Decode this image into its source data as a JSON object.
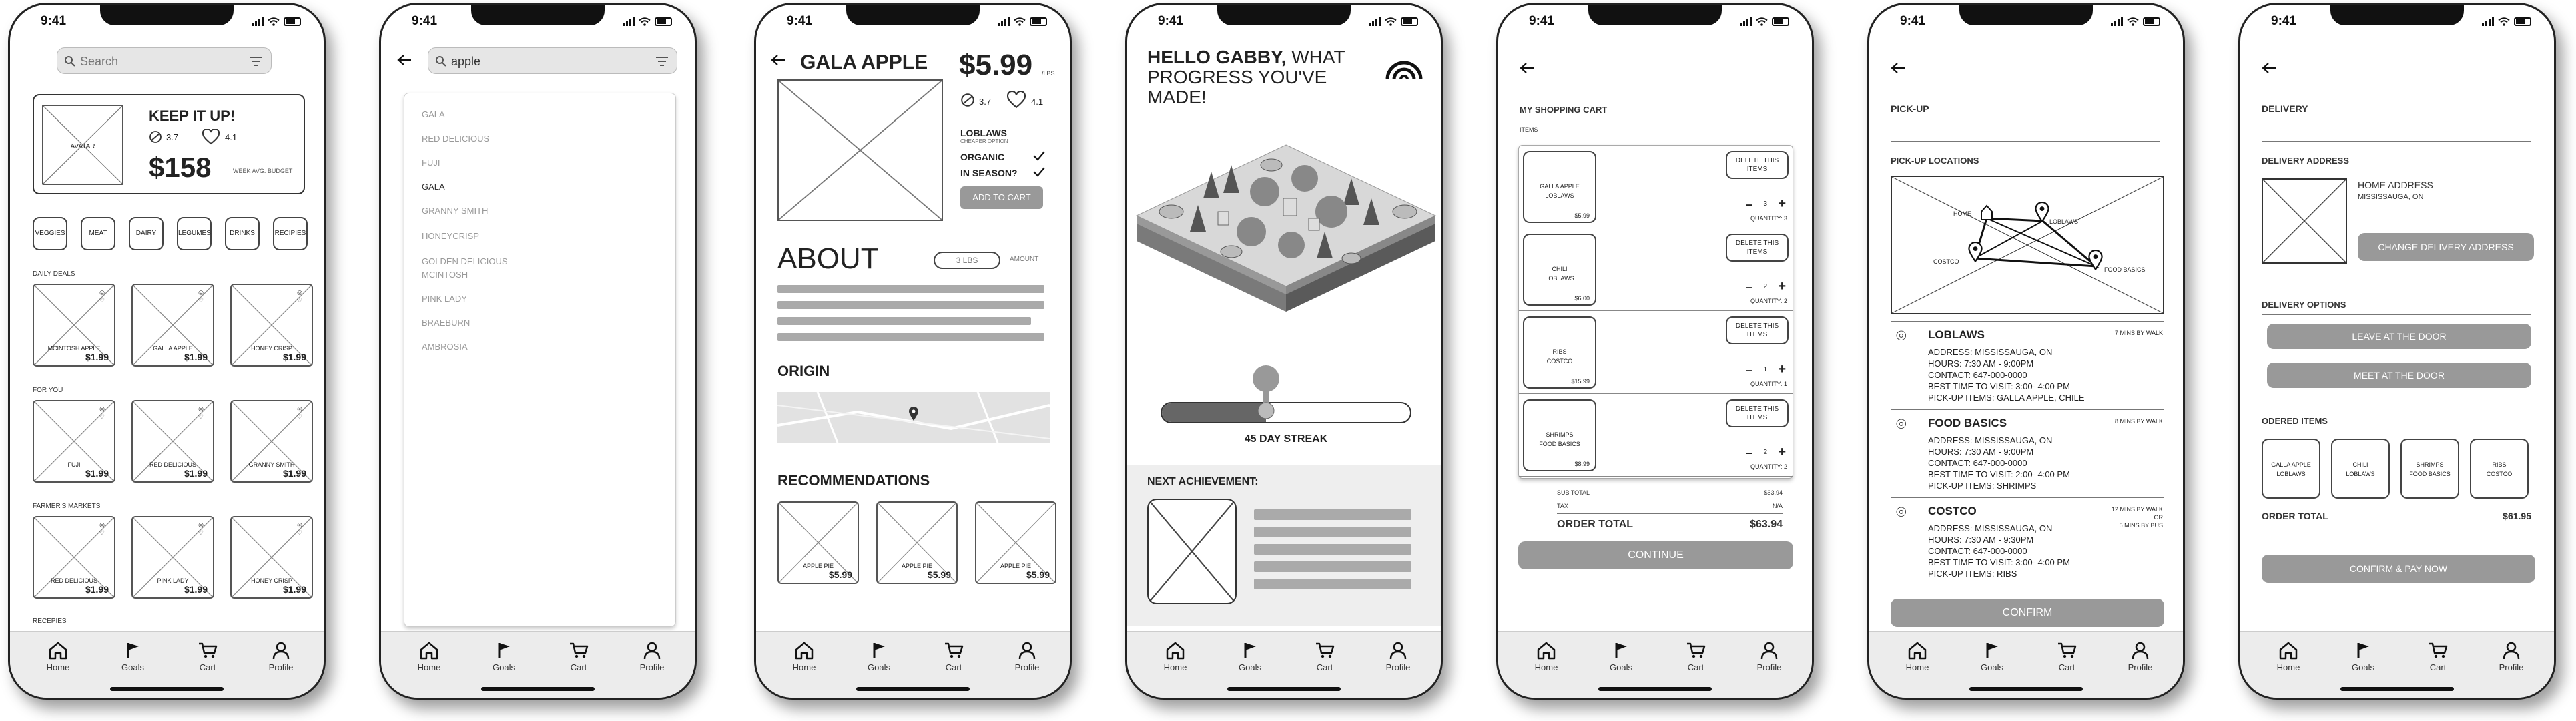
{
  "status_time": "9:41",
  "tabs": [
    "Home",
    "Goals",
    "Cart",
    "Profile"
  ],
  "screen1": {
    "search_placeholder": "Search",
    "avatar": "AVATAR",
    "title": "KEEP IT UP!",
    "stat1": "3.7",
    "stat2": "4.1",
    "budget": "$158",
    "budget_label": "WEEK AVG. BUDGET",
    "categories": [
      "VEGGIES",
      "MEAT",
      "DAIRY",
      "LEGUMES",
      "DRINKS",
      "RECIPIES"
    ],
    "sections": [
      {
        "title": "DAILY DEALS",
        "items": [
          {
            "name": "MCINTOSH APPLE",
            "price": "$1.99"
          },
          {
            "name": "GALLA APPLE",
            "price": "$1.99"
          },
          {
            "name": "HONEY CRISP",
            "price": "$1.99"
          }
        ]
      },
      {
        "title": "FOR YOU",
        "items": [
          {
            "name": "FUJI",
            "price": "$1.99"
          },
          {
            "name": "RED DELICIOUS",
            "price": "$1.99"
          },
          {
            "name": "GRANNY SMITH",
            "price": "$1.99"
          }
        ]
      },
      {
        "title": "FARMER'S MARKETS",
        "items": [
          {
            "name": "RED DELICIOUS",
            "price": "$1.99"
          },
          {
            "name": "PINK LADY",
            "price": "$1.99"
          },
          {
            "name": "HONEY CRISP",
            "price": "$1.99"
          }
        ]
      }
    ],
    "recepies_title": "RECEPIES"
  },
  "screen2": {
    "search_value": "apple",
    "results": [
      "GALA",
      "RED DELICIOUS",
      "FUJI",
      "GALA",
      "GRANNY SMITH",
      "HONEYCRISP",
      "GOLDEN DELICIOUS",
      "MCINTOSH",
      "PINK LADY",
      "BRAEBURN",
      "AMBROSIA"
    ]
  },
  "screen3": {
    "title": "GALA APPLE",
    "price": "$5.99",
    "price_unit": "/LBS",
    "stat1": "3.7",
    "stat2": "4.1",
    "store": "LOBLAWS",
    "store_sub": "CHEAPER OPTION",
    "organic": "ORGANIC",
    "in_season": "IN SEASON?",
    "add_to_cart": "ADD TO CART",
    "about": "ABOUT",
    "amount_value": "3 LBS",
    "amount_label": "AMOUNT",
    "origin": "ORIGIN",
    "recommendations": "RECOMMENDATIONS",
    "recs": [
      {
        "name": "APPLE PIE",
        "price": "$5.99"
      },
      {
        "name": "APPLE PIE",
        "price": "$5.99"
      },
      {
        "name": "APPLE PIE",
        "price": "$5.99"
      }
    ]
  },
  "screen4": {
    "greeting_bold": "HELLO GABBY,",
    "greeting_rest": "WHAT",
    "greeting_line2": "PROGRESS YOU'VE",
    "greeting_line3": "MADE!",
    "streak": "45 DAY STREAK",
    "streak_progress": 0.42,
    "next_achievement": "NEXT ACHIEVEMENT:"
  },
  "screen5": {
    "title": "MY SHOPPING CART",
    "items_label": "ITEMS",
    "items": [
      {
        "name": "GALLA APPLE",
        "store": "LOBLAWS",
        "price": "$5.99",
        "qty": "QUANTITY: 3",
        "n": "3"
      },
      {
        "name": "CHILI",
        "store": "LOBLAWS",
        "price": "$6.00",
        "qty": "QUANTITY: 2",
        "n": "2"
      },
      {
        "name": "RIBS",
        "store": "COSTCO",
        "price": "$15.99",
        "qty": "QUANTITY: 1",
        "n": "1"
      },
      {
        "name": "SHRIMPS",
        "store": "FOOD BASICS",
        "price": "$8.99",
        "qty": "QUANTITY: 2",
        "n": "2"
      }
    ],
    "delete_label": "DELETE THIS ITEMS",
    "sub_total_label": "SUB TOTAL",
    "sub_total": "$63.94",
    "tax_label": "TAX",
    "tax": "N/A",
    "order_total_label": "ORDER TOTAL",
    "order_total": "$63.94",
    "continue": "CONTINUE"
  },
  "screen6": {
    "title": "PICK-UP",
    "locations_title": "PICK-UP LOCATIONS",
    "map_labels": [
      "HOME",
      "LOBLAWS",
      "COSTCO",
      "FOOD BASICS"
    ],
    "stores": [
      {
        "name": "LOBLAWS",
        "distance": "7 MINS BY WALK",
        "address": "ADDRESS:  MISSISSAUGA, ON",
        "hours": "HOURS:  7:30 AM - 9:00PM",
        "contact": "CONTACT:  647-000-0000",
        "best": "BEST TIME TO VISIT:  3:00- 4:00 PM",
        "pickup": "PICK-UP ITEMS:  GALLA APPLE, CHILE"
      },
      {
        "name": "FOOD BASICS",
        "distance": "8 MINS BY WALK",
        "address": "ADDRESS:  MISSISSAUGA, ON",
        "hours": "HOURS:  7:30 AM - 9:00PM",
        "contact": "CONTACT:  647-000-0000",
        "best": "BEST TIME TO VISIT:  2:00- 4:00 PM",
        "pickup": "PICK-UP ITEMS:  SHRIMPS"
      },
      {
        "name": "COSTCO",
        "distance": "12 MINS BY WALK",
        "distance2": "OR",
        "distance3": "5 MINS BY BUS",
        "address": "ADDRESS:  MISSISSAUGA, ON",
        "hours": "HOURS:  7:30 AM - 9:30PM",
        "contact": "CONTACT:  647-000-0000",
        "best": "BEST TIME TO VISIT:  3:00- 4:00 PM",
        "pickup": "PICK-UP ITEMS:  RIBS"
      }
    ],
    "confirm": "CONFIRM"
  },
  "screen7": {
    "title": "DELIVERY",
    "address_title": "DELIVERY ADDRESS",
    "home_address": "HOME ADDRESS",
    "city": "MISSISSAUGA, ON",
    "change_address": "CHANGE DELIVERY ADDRESS",
    "options_title": "DELIVERY OPTIONS",
    "leave": "LEAVE AT THE DOOR",
    "meet": "MEET AT THE  DOOR",
    "ordered_title": "ODERED ITEMS",
    "items": [
      {
        "name": "GALLA APPLE",
        "store": "LOBLAWS"
      },
      {
        "name": "CHILI",
        "store": "LOBLAWS"
      },
      {
        "name": "SHRIMPS",
        "store": "FOOD BASICS"
      },
      {
        "name": "RIBS",
        "store": "COSTCO"
      }
    ],
    "order_total_label": "ORDER TOTAL",
    "order_total": "$61.95",
    "confirm_pay": "CONFIRM & PAY NOW"
  },
  "colors": {
    "gray_button": "#999999",
    "bar_gray": "#aaaaaa",
    "map_gray": "#dddddd"
  }
}
